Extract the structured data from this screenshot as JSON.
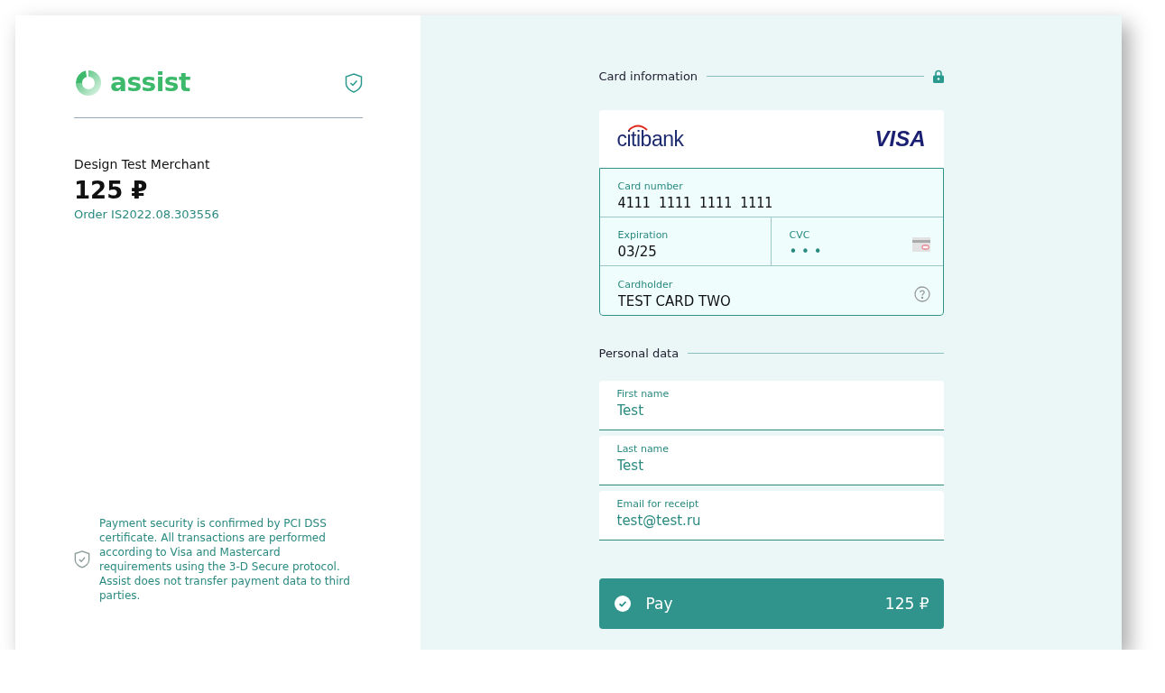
{
  "brand": {
    "name": "assist"
  },
  "merchant": {
    "name": "Design Test Merchant",
    "amount": "125 ₽",
    "order": "Order IS2022.08.303556"
  },
  "security_note": "Payment security is confirmed by PCI DSS certificate. All transactions are performed according to Visa and Mastercard requirements using the 3-D Secure protocol. Assist does not transfer payment data to third parties.",
  "card_section": {
    "title": "Card information",
    "bank": "citibank",
    "network": "VISA",
    "fields": [
      {
        "kind": "number",
        "label": "Card number",
        "value": "4111 1111 1111 1111"
      },
      {
        "kind": "expiry",
        "label": "Expiration",
        "value": "03/25"
      },
      {
        "kind": "cvc",
        "label": "CVC",
        "value": "• • •"
      },
      {
        "kind": "holder",
        "label": "Cardholder",
        "value": "TEST CARD TWO"
      }
    ]
  },
  "personal_section": {
    "title": "Personal data",
    "fields": [
      {
        "label": "First name",
        "value": "Test"
      },
      {
        "label": "Last name",
        "value": "Test"
      },
      {
        "label": "Email for receipt",
        "value": "test@test.ru"
      }
    ]
  },
  "pay_button": {
    "label": "Pay",
    "amount": "125 ₽"
  }
}
